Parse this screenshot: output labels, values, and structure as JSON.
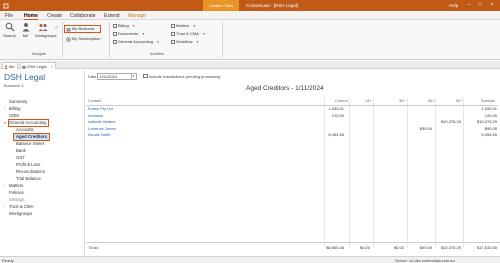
{
  "window": {
    "title": "ContextLaw - [DSH Legal]",
    "context_tab_group": "Creditor Tools",
    "help": "Help",
    "controls": [
      "–",
      "□",
      "×"
    ]
  },
  "ribbon_tabs": [
    {
      "label": "File"
    },
    {
      "label": "Home"
    },
    {
      "label": "Create"
    },
    {
      "label": "Collaborate"
    },
    {
      "label": "Extend"
    },
    {
      "label": "Manage"
    }
  ],
  "navigate_group": {
    "label": "Navigate",
    "search": "Search",
    "me": "Me",
    "workgroups": "Workgroups",
    "forward": "→"
  },
  "business_group": {
    "my_business": "My Business",
    "my_subscription": "My Subscription"
  },
  "activities_group": {
    "label": "Activities",
    "items": [
      "Billing",
      "Documents",
      "General Accounting",
      "Matters",
      "Trust & CMA",
      "Workflow"
    ]
  },
  "doc_tabs": [
    {
      "label": "Me"
    },
    {
      "label": "DSH Legal"
    }
  ],
  "left_panel": {
    "title": "DSH Legal",
    "subtitle": "Business 1",
    "nav": {
      "summary": "Summary",
      "billing": "Billing",
      "crm": "CRM",
      "general_accounting": "General Accounting",
      "accounts": "Accounts",
      "aged_creditors": "Aged Creditors",
      "balance_sheet": "Balance Sheet",
      "bank": "Bank",
      "gst": "GST",
      "profit_loss": "Profit & Loss",
      "reconciliations": "Reconciliations",
      "trial_balance": "Trial Balance",
      "matters": "Matters",
      "policies": "Policies",
      "settings": "Settings",
      "trust_cma": "Trust & CMA",
      "workgroups": "Workgroups"
    }
  },
  "report": {
    "date_label": "Date",
    "date_value": "1/11/2024",
    "include_pending_label": "Include transactions pending processing",
    "title": "Aged Creditors - 1/11/2024",
    "columns": [
      "Contact",
      "Current",
      "14+",
      "30+",
      "60+",
      "90+",
      "Subtotal"
    ],
    "rows": [
      {
        "contact": "Evans Pty Ltd",
        "current": "1,050.01",
        "d14": "",
        "d30": "",
        "d60": "",
        "d90": "",
        "subtotal": "1,050.01"
      },
      {
        "contact": "Infotrack",
        "current": "120.00",
        "d14": "",
        "d30": "",
        "d60": "",
        "d90": "",
        "subtotal": "120.00"
      },
      {
        "contact": "Isabelle Waters",
        "current": "",
        "d14": "",
        "d30": "",
        "d60": "",
        "d90": "$10,376.29",
        "subtotal": "$10,376.29"
      },
      {
        "contact": "Lorrence Jones",
        "current": "",
        "d14": "",
        "d30": "",
        "d60": "$90.00",
        "d90": "",
        "subtotal": "$90.00"
      },
      {
        "contact": "Nicola Smith",
        "current": "5,454.55",
        "d14": "",
        "d30": "",
        "d60": "",
        "d90": "",
        "subtotal": "5,454.55"
      }
    ],
    "totals": {
      "label": "Totals",
      "current": "$6,665.46",
      "d14": "$0.00",
      "d30": "$0.00",
      "d60": "$90.00",
      "d90": "$10,376.29",
      "subtotal": "$17,632.65"
    }
  },
  "status_bar": {
    "left": "Ready",
    "right": "Server: v2-dev.contextlaw.com.au"
  },
  "colors": {
    "accent": "#c05a16",
    "context_tab": "#e89426",
    "highlight": "#d8561a",
    "link": "#1f5fb0",
    "selected_bg": "#cfe3f6"
  }
}
